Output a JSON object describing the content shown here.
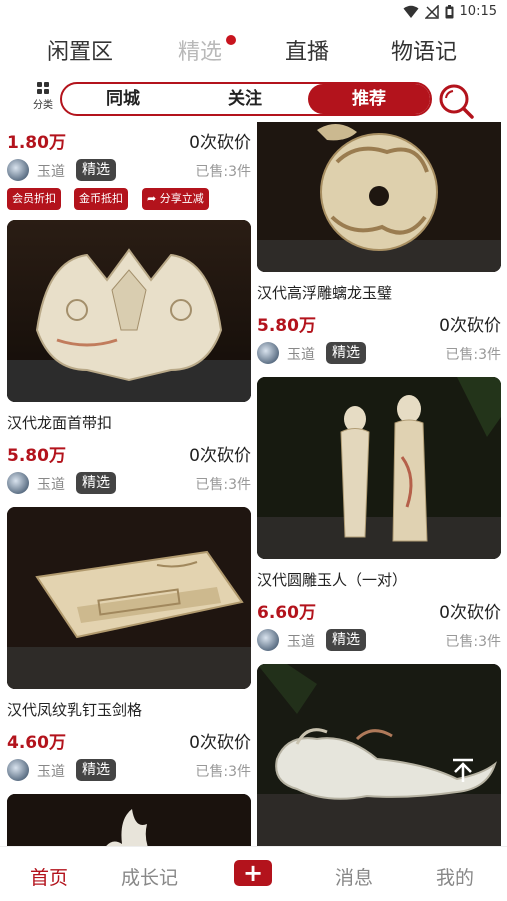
{
  "status": {
    "time": "10:15"
  },
  "top_tabs": [
    {
      "label": "闲置区"
    },
    {
      "label": "精选"
    },
    {
      "label": "直播"
    },
    {
      "label": "物语记"
    }
  ],
  "filter": {
    "category_label": "分类",
    "segments": [
      "同城",
      "关注",
      "推荐"
    ],
    "active_segment": "推荐"
  },
  "left_column": {
    "first_partial": {
      "price": "1.80万",
      "bargain": "0次砍价",
      "shop": "玉道",
      "badge": "精选",
      "sold": "已售:3件",
      "tags": [
        "会员折扣",
        "金币抵扣",
        "分享立减"
      ]
    },
    "items": [
      {
        "title": "汉代龙面首带扣",
        "price": "5.80万",
        "bargain": "0次砍价",
        "shop": "玉道",
        "badge": "精选",
        "sold": "已售:3件"
      },
      {
        "title": "汉代凤纹乳钉玉剑格",
        "price": "4.60万",
        "bargain": "0次砍价",
        "shop": "玉道",
        "badge": "精选",
        "sold": "已售:3件"
      }
    ]
  },
  "right_column": {
    "items": [
      {
        "title": "汉代高浮雕螭龙玉璧",
        "price": "5.80万",
        "bargain": "0次砍价",
        "shop": "玉道",
        "badge": "精选",
        "sold": "已售:3件"
      },
      {
        "title": "汉代圆雕玉人（一对）",
        "price": "6.60万",
        "bargain": "0次砍价",
        "shop": "玉道",
        "badge": "精选",
        "sold": "已售:3件"
      }
    ]
  },
  "tabbar": {
    "items": [
      "首页",
      "成长记",
      "消息",
      "我的"
    ],
    "plus": "+"
  },
  "colors": {
    "accent": "#b3131c",
    "badge_bg": "#444444"
  }
}
